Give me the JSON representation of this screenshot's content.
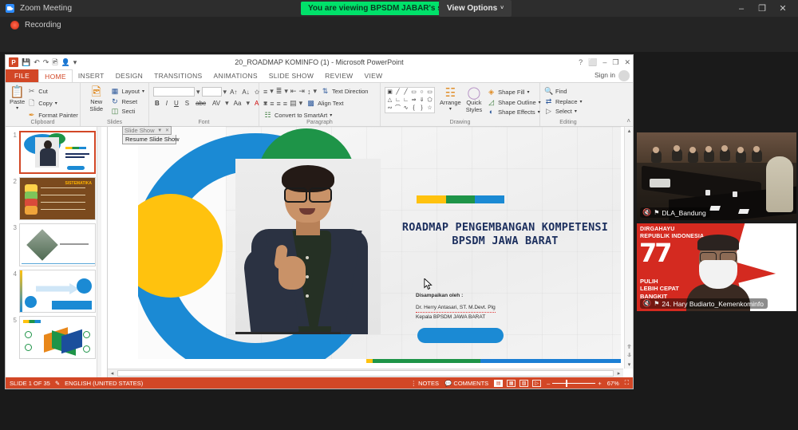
{
  "zoom_app": {
    "window_title": "Zoom Meeting",
    "viewing_banner": "You are viewing BPSDM JABAR's screen",
    "view_options_label": "View Options",
    "view_options_caret": "˅",
    "recording_label": "Recording",
    "window_buttons": {
      "minimize": "–",
      "maximize": "❐",
      "close": "✕"
    }
  },
  "powerpoint": {
    "title": "20_ROADMAP KOMINFO (1) - Microsoft PowerPoint",
    "quick_access": [
      "pp-logo",
      "save-icon",
      "undo-icon",
      "redo-icon",
      "slideshow-icon",
      "customize-icon"
    ],
    "window_buttons": {
      "help": "?",
      "ribbon_display": "⬜",
      "minimize": "–",
      "restore": "❐",
      "close": "✕"
    },
    "sign_in": "Sign in",
    "tabs": [
      {
        "label": "FILE",
        "state": "file"
      },
      {
        "label": "HOME",
        "state": "active"
      },
      {
        "label": "INSERT",
        "state": "normal"
      },
      {
        "label": "DESIGN",
        "state": "normal"
      },
      {
        "label": "TRANSITIONS",
        "state": "normal"
      },
      {
        "label": "ANIMATIONS",
        "state": "normal"
      },
      {
        "label": "SLIDE SHOW",
        "state": "normal"
      },
      {
        "label": "REVIEW",
        "state": "normal"
      },
      {
        "label": "VIEW",
        "state": "normal"
      }
    ],
    "ribbon": {
      "clipboard": {
        "group_label": "Clipboard",
        "paste": "Paste",
        "cut": "Cut",
        "copy": "Copy",
        "format_painter": "Format Painter"
      },
      "slides": {
        "group_label": "Slides",
        "new_slide": "New\nSlide",
        "new_slide_line1": "New",
        "new_slide_line2": "Slide",
        "layout": "Layout",
        "reset": "Reset",
        "section": "Secti"
      },
      "font": {
        "group_label": "Font",
        "font_name": "",
        "font_size": ""
      },
      "paragraph": {
        "group_label": "Paragraph",
        "text_direction": "Text Direction",
        "align_text": "Align Text",
        "convert_smartart": "Convert to SmartArt"
      },
      "drawing": {
        "group_label": "Drawing",
        "arrange": "Arrange",
        "quick_styles_line1": "Quick",
        "quick_styles_line2": "Styles",
        "shape_fill": "Shape Fill",
        "shape_outline": "Shape Outline",
        "shape_effects": "Shape Effects",
        "shapes": [
          "▣",
          "╲",
          "╲",
          "▭",
          "◯",
          "▭",
          "▾",
          "△",
          "┗",
          "┙",
          "⇨",
          "⇩",
          "⎔",
          "▾",
          "♫",
          "⌒",
          "∿",
          "{",
          "}",
          "☆",
          "▾"
        ]
      },
      "editing": {
        "group_label": "Editing",
        "find": "Find",
        "replace": "Replace",
        "select": "Select"
      },
      "collapse_caret": "˄"
    },
    "slideshow_toolbar": {
      "title": "Slide Show",
      "dropdown_caret": "▼",
      "close": "✕",
      "menu_item": "Resume Slide Show"
    },
    "thumbnails": [
      {
        "number": "1",
        "selected": true,
        "has_star": true
      },
      {
        "number": "2",
        "selected": false,
        "has_star": false
      },
      {
        "number": "3",
        "selected": false,
        "has_star": false
      },
      {
        "number": "4",
        "selected": false,
        "has_star": false
      },
      {
        "number": "5",
        "selected": false,
        "has_star": true
      }
    ],
    "slide": {
      "title_line1": "ROADMAP PENGEMBANGAN KOMPETENSI",
      "title_line2": "BPSDM JAWA BARAT",
      "presented_by_label": "Disampaikan oleh :",
      "presenter_name": "Dr. Herry Antasari, ST. M.Devt. Plg",
      "presenter_role": "Kepala BPSDM JAWA BARAT",
      "accent_colors": [
        "#ffc20e",
        "#1e9448",
        "#1b8ad4"
      ],
      "title_color": "#1c2f5e"
    },
    "status_bar": {
      "slide_counter": "SLIDE 1 OF 35",
      "language": "ENGLISH (UNITED STATES)",
      "notes": "NOTES",
      "comments": "COMMENTS",
      "zoom_level": "67%",
      "view_buttons": [
        "normal-view",
        "slide-sorter-view",
        "reading-view",
        "slide-show-view"
      ],
      "zoom_out": "–",
      "zoom_in": "+",
      "fit_slide": "⛶",
      "bar_color": "#d24726"
    },
    "scrollbars": {
      "h_left_arrow": "◂",
      "h_right_arrow": "▸",
      "v_up_arrow": "▴",
      "v_down_arrow": "▾",
      "v_prev": "⥣",
      "v_next": "⥥"
    }
  },
  "video_tiles": [
    {
      "name": "DLA_Bandung",
      "muted": true,
      "active_speaker": true,
      "mic_icon": "🎤",
      "pin_icon": "⚐"
    },
    {
      "name": "24. Hary Budiarto_Kemenkominfo",
      "muted": true,
      "active_speaker": false,
      "mic_icon": "🎤",
      "pin_icon": "⚐",
      "virtual_background": {
        "top_text_line1": "DIRGAHAYU",
        "top_text_line2": "REPUBLIK INDONESIA",
        "number": "77",
        "bottom_line1": "PULIH",
        "bottom_line2": "LEBIH CEPAT",
        "bottom_line3": "BANGKIT"
      }
    }
  ]
}
